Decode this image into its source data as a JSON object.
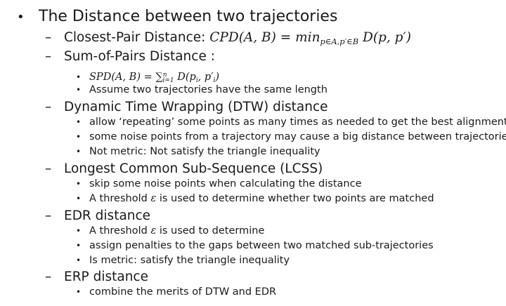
{
  "heading": "The Distance between two trajectories",
  "sections": [
    {
      "title": "Closest-Pair Distance: ",
      "formula": {
        "lhs": "CPD(A, B) = ",
        "op": "min",
        "op_sub": "p∈A,p′∈B",
        "rhs": " D(p, p′)"
      }
    },
    {
      "title": "Sum-of-Pairs Distance :",
      "formula": {
        "lhs": "SPD(A, B) = ",
        "sum": "∑",
        "sum_sub": "i=1",
        "sum_sup": "n",
        "rhs": " D(p",
        "rhs_sub1": "i",
        "rhs_mid": ", p′",
        "rhs_sub2": "i",
        "rhs_end": ")"
      },
      "items": [
        "Assume two trajectories have the same length"
      ]
    },
    {
      "title": "Dynamic Time Wrapping (DTW) distance",
      "items": [
        "allow ‘repeating’ some points as many times as needed to get the best alignment",
        "some noise points from a trajectory may cause a big distance between trajectories",
        "Not metric: Not satisfy the triangle inequality"
      ]
    },
    {
      "title": "Longest Common Sub-Sequence (LCSS)",
      "items": [
        "skip some noise points when calculating the distance"
      ],
      "threshold": {
        "before": "A threshold ",
        "symbol": "ε",
        "after": " is used to determine whether two points are matched"
      }
    },
    {
      "title": "EDR distance",
      "threshold": {
        "before": "A threshold ",
        "symbol": "ε",
        "after": " is used to determine"
      },
      "items": [
        "assign penalties to the gaps between two matched sub-trajectories",
        "Is metric: satisfy the triangle inequality"
      ]
    },
    {
      "title": "ERP distance",
      "items": [
        "combine the merits of DTW and EDR"
      ]
    }
  ],
  "symbols": {
    "bullet": "•",
    "dash": "–",
    "dot": "•"
  }
}
